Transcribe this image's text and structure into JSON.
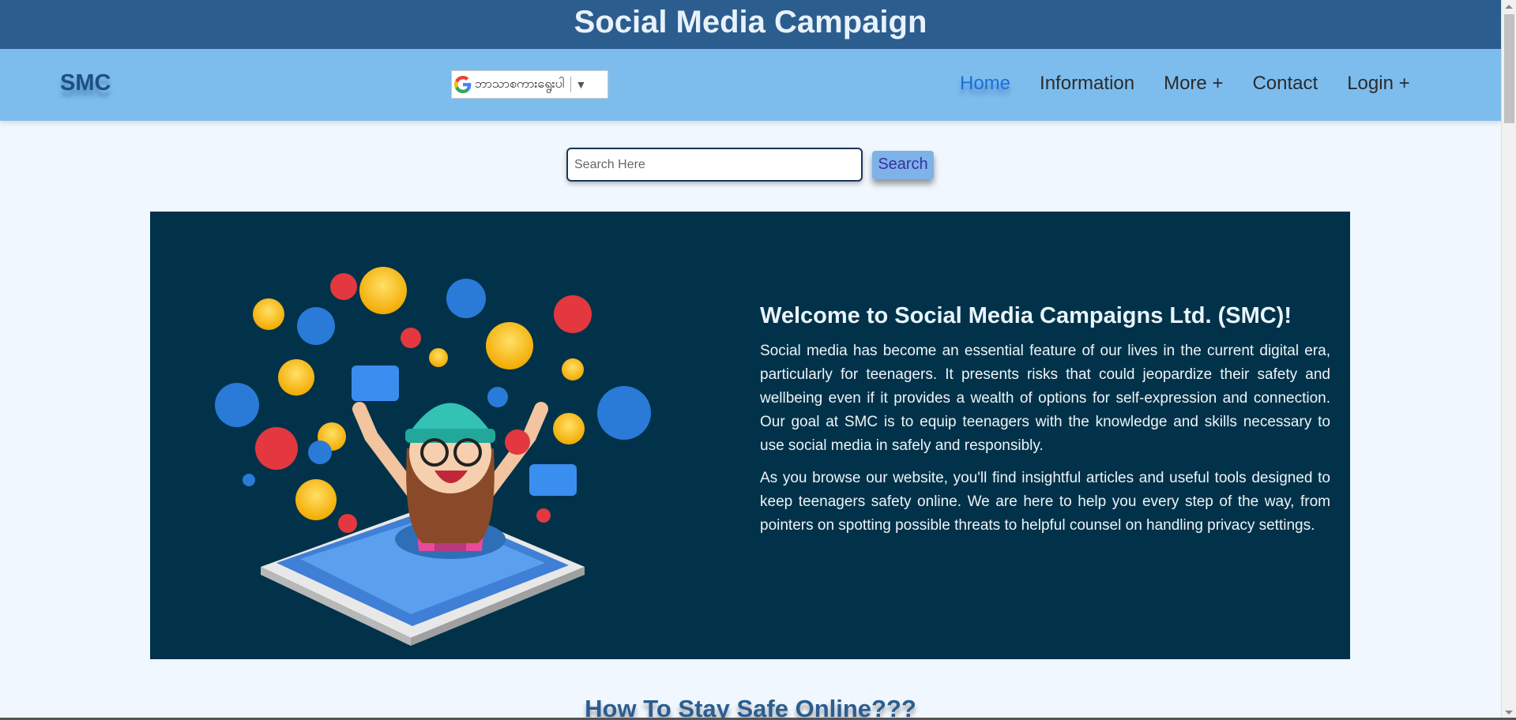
{
  "header": {
    "banner_title": "Social Media Campaign"
  },
  "navbar": {
    "brand": "SMC",
    "translate": {
      "selected_language": "ဘာသာစကားရွေးပါ",
      "icon": "google-icon"
    },
    "links": [
      {
        "label": "Home",
        "active": true
      },
      {
        "label": "Information",
        "active": false
      },
      {
        "label": "More +",
        "active": false
      },
      {
        "label": "Contact",
        "active": false
      },
      {
        "label": "Login +",
        "active": false
      }
    ]
  },
  "search": {
    "placeholder": "Search Here",
    "value": "",
    "button_label": "Search"
  },
  "hero": {
    "title": "Welcome to Social Media Campaigns Ltd. (SMC)!",
    "paragraphs": [
      "Social media has become an essential feature of our lives in the current digital era, particularly for teenagers. It presents risks that could jeopardize their safety and wellbeing even if it provides a wealth of options for self-expression and connection. Our goal at SMC is to equip teenagers with the knowledge and skills necessary to use social media in safely and responsibly.",
      "As you browse our website, you'll find insightful articles and useful tools designed to keep teenagers safety online. We are here to help you every step of the way, from pointers on spotting possible threats to helpful counsel on handling privacy settings."
    ]
  },
  "section": {
    "heading": "How To Stay Safe Online???"
  },
  "colors": {
    "banner": "#2c5d8f",
    "navbar": "#7dbdee",
    "hero_bg": "#013249",
    "page_bg": "#f0f7fe",
    "active_link": "#1a6fd9"
  }
}
